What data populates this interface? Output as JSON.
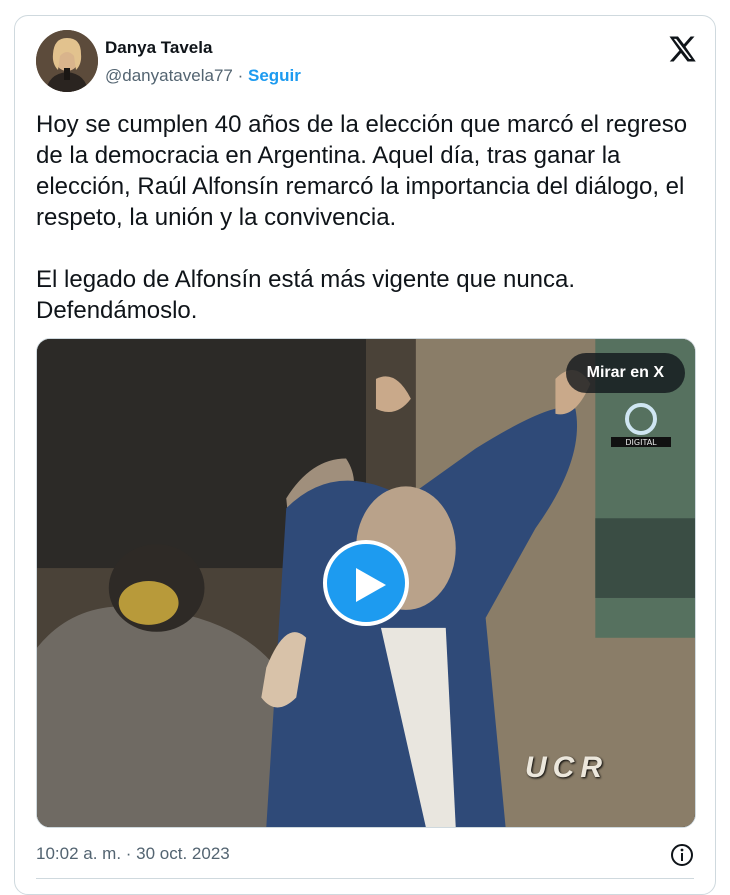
{
  "author": {
    "name": "Danya Tavela",
    "handle": "@danyatavela77",
    "separator": "·",
    "follow_label": "Seguir",
    "avatar_icon": "user-avatar"
  },
  "brand_icon": "x-logo-icon",
  "tweet": {
    "paragraph_1": "Hoy se cumplen 40 años de la elección que marcó el regreso de la democracia en Argentina. Aquel día, tras ganar la elección, Raúl Alfonsín remarcó la importancia del diálogo, el respeto, la unión y la convivencia.",
    "paragraph_2": "El legado de Alfonsín está más vigente que nunca. Defendámoslo."
  },
  "media": {
    "watch_label": "Mirar en X",
    "overlay_text": "UCR",
    "channel_watermark": "DIGITAL",
    "play_icon": "play-icon"
  },
  "footer": {
    "timestamp": "10:02 a. m. · 30 oct. 2023",
    "info_icon": "info-icon"
  },
  "colors": {
    "accent": "#1d9bf0",
    "text": "#0f1419",
    "muted": "#536471",
    "border": "#cfd9de"
  }
}
